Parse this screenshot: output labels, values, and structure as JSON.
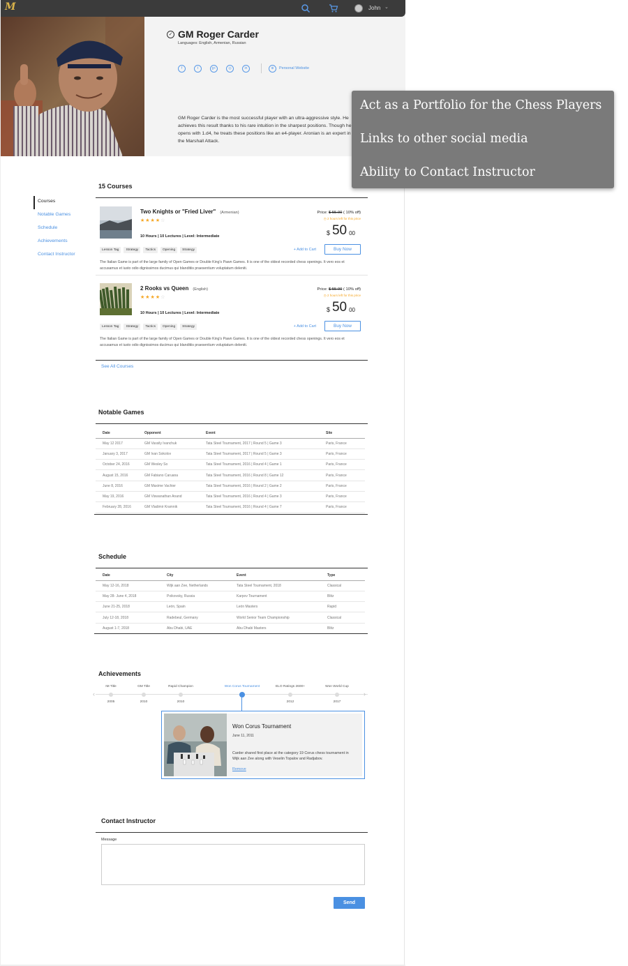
{
  "header": {
    "logo_text": "M",
    "user_name": "John"
  },
  "profile": {
    "name": "GM Roger Carder",
    "languages": "Languages: English, Armenian, Russian",
    "socials": [
      {
        "icon": "facebook-icon",
        "glyph": "f"
      },
      {
        "icon": "twitter-icon",
        "glyph": "t"
      },
      {
        "icon": "google-plus-icon",
        "glyph": "g+"
      },
      {
        "icon": "instagram-icon",
        "glyph": "◎"
      },
      {
        "icon": "linkedin-icon",
        "glyph": "in"
      }
    ],
    "website_label": "Personal Website",
    "bio": "GM Roger Carder is the most successful player with an ultra-aggressive style. He achieves this result thanks to his rare intuition in the sharpest positions. Though he opens with 1.d4, he treats these positions like an e4-player. Aronian is an expert in the Marshall Attack."
  },
  "sidenav": [
    "Courses",
    "Notable Games",
    "Schedule",
    "Achievements",
    "Contact Instructor"
  ],
  "courses": {
    "title": "15 Courses",
    "see_all": "See All Courses",
    "items": [
      {
        "title": "Two Knights or \"Fried Liver\"",
        "language": "(Armenian)",
        "stars_on": "★★★★",
        "stars_off": "☆",
        "meta": "10 Hours  |  10 Lectures  |  Level: Intermediate",
        "price_label": "Price:",
        "old_price": "$ 55.00",
        "discount": "( 10% off)",
        "offer": "2 hours left for this price",
        "currency": "$",
        "amount": "50",
        "cents": "00",
        "tags": [
          "Lesson Tag",
          "Strategy",
          "Tactics",
          "Opening",
          "Strategy"
        ],
        "cart": "+ Add to Cart",
        "buy": "Buy Now",
        "description": "The Italian Game is part of the large family of Open Games or Double King's Pawn Games. It is one of the oldest recorded chess openings. It vero eos et accusamus et iusto odio dignissimos ducimus qui blanditiis praesentium voluptatum deleniti."
      },
      {
        "title": "2 Rooks vs Queen",
        "language": "(English)",
        "stars_on": "★★★★",
        "stars_off": "☆",
        "meta": "10 Hours  |  10 Lectures  |  Level: Intermediate",
        "price_label": "Price:",
        "old_price": "$ 55.00",
        "discount": "( 10% off)",
        "offer": "2 hours left for this price",
        "currency": "$",
        "amount": "50",
        "cents": "00",
        "tags": [
          "Lesson Tag",
          "Strategy",
          "Tactics",
          "Opening",
          "Strategy"
        ],
        "cart": "+ Add to Cart",
        "buy": "Buy Now",
        "description": "The Italian Game is part of the large family of Open Games or Double King's Pawn Games. It is one of the oldest recorded chess openings. It vero eos et accusamus et iusto odio dignissimos ducimus qui blanditiis praesentium voluptatum deleniti."
      }
    ]
  },
  "notable_games": {
    "title": "Notable Games",
    "columns": [
      "Date",
      "Opponent",
      "Event",
      "Site"
    ],
    "rows": [
      [
        "May 12 2017",
        "GM Vassily Ivanchuk",
        "Tata Steel Tournament, 2017 | Round 5 | Game 3",
        "Paris, France"
      ],
      [
        "January 3, 2017",
        "GM Ivan Sokolov",
        "Tata Steel Tournament, 2017 | Round 5 | Game 3",
        "Paris, France"
      ],
      [
        "October 24, 2016",
        "GM Wesley So",
        "Tata Steel Tournament, 2016 | Round 4 | Game 1",
        "Paris, France"
      ],
      [
        "August 15, 2016",
        "GM Fabiano Caruana",
        "Tata Steel Tournament, 2016 | Round 8 | Game 12",
        "Paris, France"
      ],
      [
        "June 8, 2016",
        "GM Maxime Vachier",
        "Tata Steel Tournament, 2016 | Round 2 | Game 2",
        "Paris, France"
      ],
      [
        "May 19, 2016",
        "GM Viswanathan Anand",
        "Tata Steel Tournament, 2016 | Round 4 | Game 3",
        "Paris, France"
      ],
      [
        "February 28, 2016",
        "GM Vladimir Kramnik",
        "Tata Steel Tournament, 2016 | Round 4 | Game 7",
        "Paris, France"
      ]
    ]
  },
  "schedule": {
    "title": "Schedule",
    "columns": [
      "Date",
      "City",
      "Event",
      "Type"
    ],
    "rows": [
      [
        "May 12-16, 2018",
        "Wijk aan Zee, Netherlands",
        "Tata Steel Tournament, 2018",
        "Classical"
      ],
      [
        "May 28- June 4, 2018",
        "Poikovsky, Russia",
        "Karpov Tournament",
        "Blitz"
      ],
      [
        "June 21-25, 2018",
        "León, Spain",
        "León Masters",
        "Rapid"
      ],
      [
        "July 12-18, 2018",
        "Radebeul, Germany",
        "World Senior Team Championship",
        "Classical"
      ],
      [
        "August 1-7, 2018",
        "Abu Dhabi, UAE",
        "Abu Dhabi Masters",
        "Blitz"
      ]
    ]
  },
  "achievements": {
    "title": "Achievements",
    "timeline": [
      {
        "label": "IM Title",
        "year": "2005"
      },
      {
        "label": "GM Title",
        "year": "2010"
      },
      {
        "label": "Rapid Champion",
        "year": "2010"
      },
      {
        "label": "Won Corus Tournament",
        "year": ""
      },
      {
        "label": "ELO Ratings 2600+",
        "year": "2012"
      },
      {
        "label": "Won World Cup",
        "year": "2017"
      }
    ],
    "active_index": 3,
    "card": {
      "title": "Won Corus Tournament",
      "date": "June 11, 2011",
      "text": "Carder shared first place at the category 19 Corus chess tournament in Wijk aan Zee along with Veselin Topalov and Radjabov.",
      "link": "Remove"
    }
  },
  "contact": {
    "title": "Contact Instructor",
    "message_label": "Message",
    "message_value": "",
    "send": "Send"
  },
  "callout": [
    "Act as a Portfolio for the Chess Players",
    "Links to other social media",
    "Ability to Contact Instructor"
  ],
  "colors": {
    "accent": "#4a90e2",
    "star": "#f5a623",
    "topbar": "#3b3b3b",
    "callout": "#7a7a7a"
  }
}
